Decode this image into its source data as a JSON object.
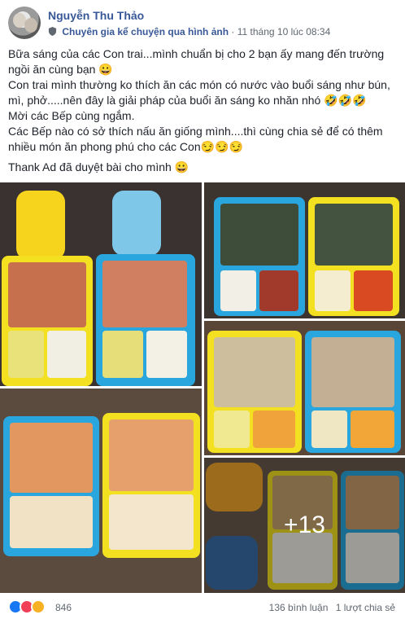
{
  "post": {
    "author": "Nguyễn Thu Thảo",
    "badge": "Chuyên gia kể chuyện qua hình ảnh",
    "separator": "·",
    "timestamp": "11 tháng 10 lúc 08:34",
    "lines": [
      "Bữa sáng của các Con trai...mình chuẩn bị cho 2 bạn ấy mang đến trường ngồi ăn cùng bạn 😀",
      "Con trai mình thường ko thích ăn các món có nước vào buổi sáng như bún, mì, phở.....nên đây là giải pháp của buổi ăn sáng ko nhăn nhó 🤣🤣🤣",
      "Mời các Bếp cùng ngắm.",
      "Các Bếp nào có sở thích nấu ăn giống mình....thì cùng chia sẻ để có thêm nhiều món ăn phong phú cho các Con😏😏😏",
      "Thank Ad đã duyệt bài cho mình 😀"
    ]
  },
  "photos": {
    "more_label": "+13"
  },
  "footer": {
    "reaction_count": "846",
    "comments": "136 bình luận",
    "shares": "1 lượt chia sẻ"
  },
  "colors": {
    "link": "#385898",
    "muted": "#606770",
    "lunchbox_yellow": "#f2e021",
    "lunchbox_blue": "#2aa6df"
  }
}
